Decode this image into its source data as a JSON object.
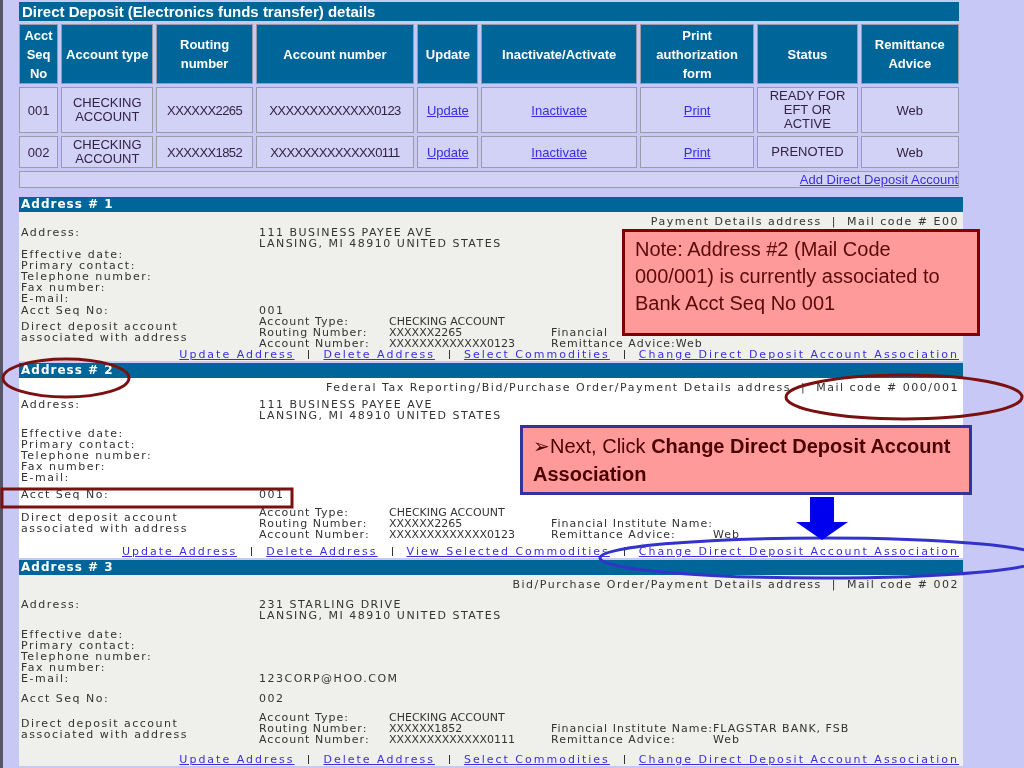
{
  "table": {
    "title": "Direct Deposit (Electronics funds transfer) details",
    "columns": [
      "Acct Seq No",
      "Account type",
      "Routing number",
      "Account number",
      "Update",
      "Inactivate/Activate",
      "Print authorization form",
      "Status",
      "Remittance Advice"
    ],
    "rows": [
      {
        "seq": "001",
        "account_type": "CHECKING ACCOUNT",
        "routing": "XXXXXX2265",
        "account_number": "XXXXXXXXXXXXX0123",
        "update": "Update",
        "toggle": "Inactivate",
        "print": "Print",
        "status": "READY FOR EFT OR ACTIVE",
        "remittance": "Web"
      },
      {
        "seq": "002",
        "account_type": "CHECKING ACCOUNT",
        "routing": "XXXXXX1852",
        "account_number": "XXXXXXXXXXXXX0111",
        "update": "Update",
        "toggle": "Inactivate",
        "print": "Print",
        "status": "PRENOTED",
        "remittance": "Web"
      }
    ],
    "add_link": "Add Direct Deposit Account"
  },
  "addresses": [
    {
      "title": "Address # 1",
      "shaded": true,
      "header": "Payment Details address  |  Mail code # E00",
      "fields": [
        {
          "label": "Address:",
          "value_lines": [
            "111 BUSINESS PAYEE AVE",
            "LANSING, MI 48910 UNITED STATES"
          ]
        },
        {
          "label": "Effective date:"
        },
        {
          "label": "Primary contact:"
        },
        {
          "label": "Telephone number:"
        },
        {
          "label": "Fax number:"
        },
        {
          "label": "E-mail:"
        },
        {
          "label": "Acct Seq No:",
          "value_lines": [
            "001"
          ]
        }
      ],
      "direct_deposit": {
        "label": "Direct deposit account associated with address",
        "rows": [
          {
            "label": "Account Type:",
            "value": "CHECKING ACCOUNT"
          },
          {
            "label": "Routing Number:",
            "value": "XXXXXX2265",
            "label2": "Financial"
          },
          {
            "label": "Account Number:",
            "value": "XXXXXXXXXXXXX0123",
            "label2": "Remittance Advice:",
            "value2": "Web"
          }
        ]
      },
      "links": [
        "Update Address",
        "Delete Address",
        "Select Commodities",
        "Change Direct Deposit Account Association"
      ]
    },
    {
      "title": "Address # 2",
      "shaded": false,
      "header": "Federal Tax Reporting/Bid/Purchase Order/Payment Details address  |  Mail code # 000/001",
      "fields": [
        {
          "label": "Address:",
          "value_lines": [
            "111 BUSINESS PAYEE AVE",
            "LANSING, MI 48910 UNITED STATES"
          ]
        },
        {
          "label": "Effective date:"
        },
        {
          "label": "Primary contact:"
        },
        {
          "label": "Telephone number:"
        },
        {
          "label": "Fax number:"
        },
        {
          "label": "E-mail:"
        },
        {
          "label": "Acct Seq No:",
          "value_lines": [
            "001"
          ]
        }
      ],
      "direct_deposit": {
        "label": "Direct deposit account associated with address",
        "rows": [
          {
            "label": "Account Type:",
            "value": "CHECKING ACCOUNT"
          },
          {
            "label": "Routing Number:",
            "value": "XXXXXX2265",
            "label2": "Financial Institute Name:"
          },
          {
            "label": "Account Number:",
            "value": "XXXXXXXXXXXXX0123",
            "label2": "Remittance Advice:",
            "value2": "Web"
          }
        ]
      },
      "links": [
        "Update Address",
        "Delete Address",
        "View Selected Commodities",
        "Change Direct Deposit Account Association"
      ]
    },
    {
      "title": "Address # 3",
      "shaded": true,
      "header": "Bid/Purchase Order/Payment Details address  |  Mail code # 002",
      "fields": [
        {
          "label": "Address:",
          "value_lines": [
            "231 STARLING DRIVE",
            "LANSING, MI 48910 UNITED STATES"
          ]
        },
        {
          "label": "Effective date:"
        },
        {
          "label": "Primary contact:"
        },
        {
          "label": "Telephone number:"
        },
        {
          "label": "Fax number:"
        },
        {
          "label": "E-mail:",
          "value_lines": [
            "123CORP@HOO.COM"
          ]
        },
        {
          "label": "Acct Seq No:",
          "value_lines": [
            "002"
          ]
        }
      ],
      "direct_deposit": {
        "label": "Direct deposit account associated with address",
        "rows": [
          {
            "label": "Account Type:",
            "value": "CHECKING ACCOUNT"
          },
          {
            "label": "Routing Number:",
            "value": "XXXXXX1852",
            "label2": "Financial Institute Name:",
            "value2": "FLAGSTAR BANK, FSB"
          },
          {
            "label": "Account Number:",
            "value": "XXXXXXXXXXXXX0111",
            "label2": "Remittance Advice:",
            "value2": "Web"
          }
        ]
      },
      "links": [
        "Update Address",
        "Delete Address",
        "Select Commodities",
        "Change Direct Deposit Account Association"
      ]
    }
  ],
  "callouts": [
    {
      "kind": "note",
      "text": "Note: Address #2 (Mail Code 000/001) is currently associated to Bank Acct Seq No 001"
    },
    {
      "kind": "instruction",
      "text": "➢Next, Click **Change Direct Deposit Account Association**"
    }
  ]
}
